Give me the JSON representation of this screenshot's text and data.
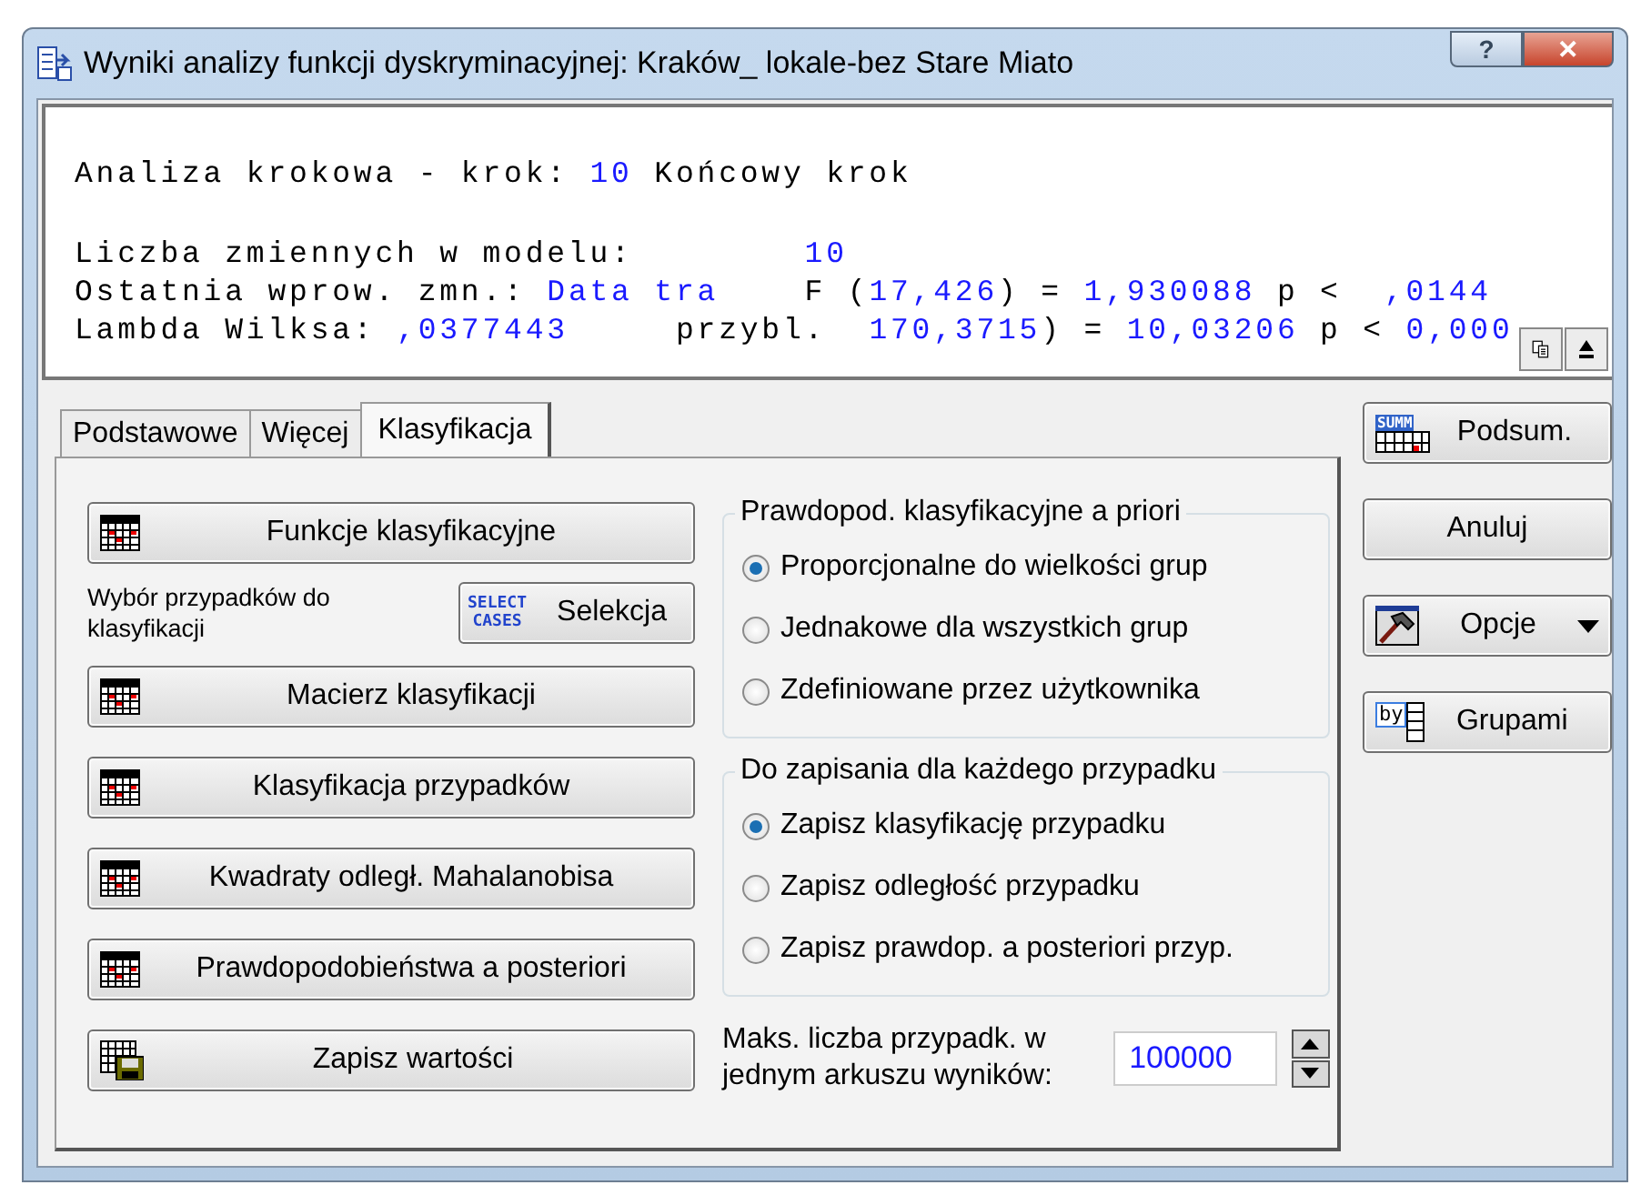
{
  "window": {
    "title": "Wyniki analizy funkcji dyskryminacyjnej: Kraków_ lokale-bez Stare Miato",
    "controls": [
      {
        "kind": "help",
        "label": "?"
      },
      {
        "kind": "close",
        "label": "✕"
      }
    ]
  },
  "output": {
    "paragraphs": [
      [
        [
          {
            "text": "Analiza krokowa - krok: ",
            "kind": "label"
          },
          {
            "text": "10",
            "kind": "value"
          },
          {
            "text": " Końcowy krok",
            "kind": "label"
          }
        ]
      ],
      [
        [
          {
            "text": "Liczba zmiennych w modelu:        ",
            "kind": "label"
          },
          {
            "text": "10",
            "kind": "value"
          }
        ],
        [
          {
            "text": "Ostatnia wprow. zmn.: ",
            "kind": "label"
          },
          {
            "text": "Data tra",
            "kind": "value"
          },
          {
            "text": "    F (",
            "kind": "label"
          },
          {
            "text": "17,426",
            "kind": "value"
          },
          {
            "text": ") = ",
            "kind": "label"
          },
          {
            "text": "1,930088",
            "kind": "value"
          },
          {
            "text": " p <  ",
            "kind": "label"
          },
          {
            "text": ",0144",
            "kind": "value"
          }
        ],
        [
          {
            "text": "Lambda Wilksa: ",
            "kind": "label"
          },
          {
            "text": ",0377443",
            "kind": "value"
          },
          {
            "text": "     przybl.  ",
            "kind": "label"
          },
          {
            "text": "170,3715",
            "kind": "value"
          },
          {
            "text": ") = ",
            "kind": "label"
          },
          {
            "text": "10,03206",
            "kind": "value"
          },
          {
            "text": " p < ",
            "kind": "label"
          },
          {
            "text": "0,000",
            "kind": "value"
          }
        ]
      ]
    ]
  },
  "tabs": [
    {
      "label": "Podstawowe",
      "selected": false
    },
    {
      "label": "Więcej",
      "selected": false
    },
    {
      "label": "Klasyfikacja",
      "selected": true
    }
  ],
  "panel_items": [
    {
      "kind": "button",
      "label": "Funkcje klasyfikacyjne"
    },
    {
      "kind": "selection",
      "description": "Wybór przypadków do klasyfikacji",
      "label": "Selekcja",
      "icon_text": [
        "SELECT",
        "CASES"
      ]
    },
    {
      "kind": "button",
      "label": "Macierz klasyfikacji"
    },
    {
      "kind": "button",
      "label": "Klasyfikacja przypadków"
    },
    {
      "kind": "button",
      "label": "Kwadraty odległ. Mahalanobisa"
    },
    {
      "kind": "button",
      "label": "Prawdopodobieństwa a posteriori"
    },
    {
      "kind": "save_button",
      "label": "Zapisz wartości"
    }
  ],
  "groups": [
    {
      "title": "Prawdopod. klasyfikacyjne a priori",
      "options": [
        {
          "label": "Proporcjonalne do wielkości grup",
          "selected": true
        },
        {
          "label": "Jednakowe dla wszystkich grup",
          "selected": false
        },
        {
          "label": "Zdefiniowane przez użytkownika",
          "selected": false
        }
      ]
    },
    {
      "title": "Do zapisania dla każdego przypadku",
      "options": [
        {
          "label": "Zapisz klasyfikację przypadku",
          "selected": true
        },
        {
          "label": "Zapisz odległość przypadku",
          "selected": false
        },
        {
          "label": "Zapisz prawdop. a posteriori przyp.",
          "selected": false
        }
      ]
    }
  ],
  "max_cases": {
    "label": "Maks. liczba przypadk. w jednym arkuszu wyników:",
    "value": "100000"
  },
  "side_buttons": [
    {
      "kind": "summary",
      "label": "Podsum.",
      "icon_text": "SUMM"
    },
    {
      "kind": "plain",
      "label": "Anuluj"
    },
    {
      "kind": "options",
      "label": "Opcje"
    },
    {
      "kind": "groups",
      "label": "Grupami",
      "icon_text": "by"
    }
  ]
}
